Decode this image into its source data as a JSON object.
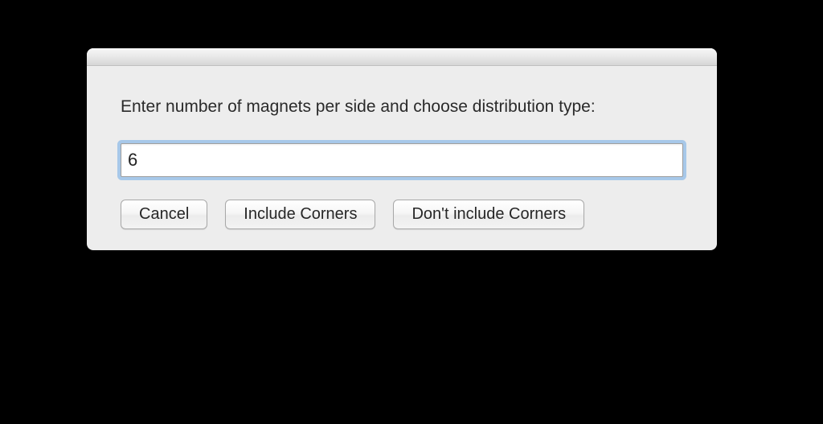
{
  "dialog": {
    "prompt": "Enter number of magnets per side and choose distribution type:",
    "input_value": "6",
    "buttons": {
      "cancel": "Cancel",
      "include": "Include Corners",
      "exclude": "Don't include Corners"
    }
  }
}
